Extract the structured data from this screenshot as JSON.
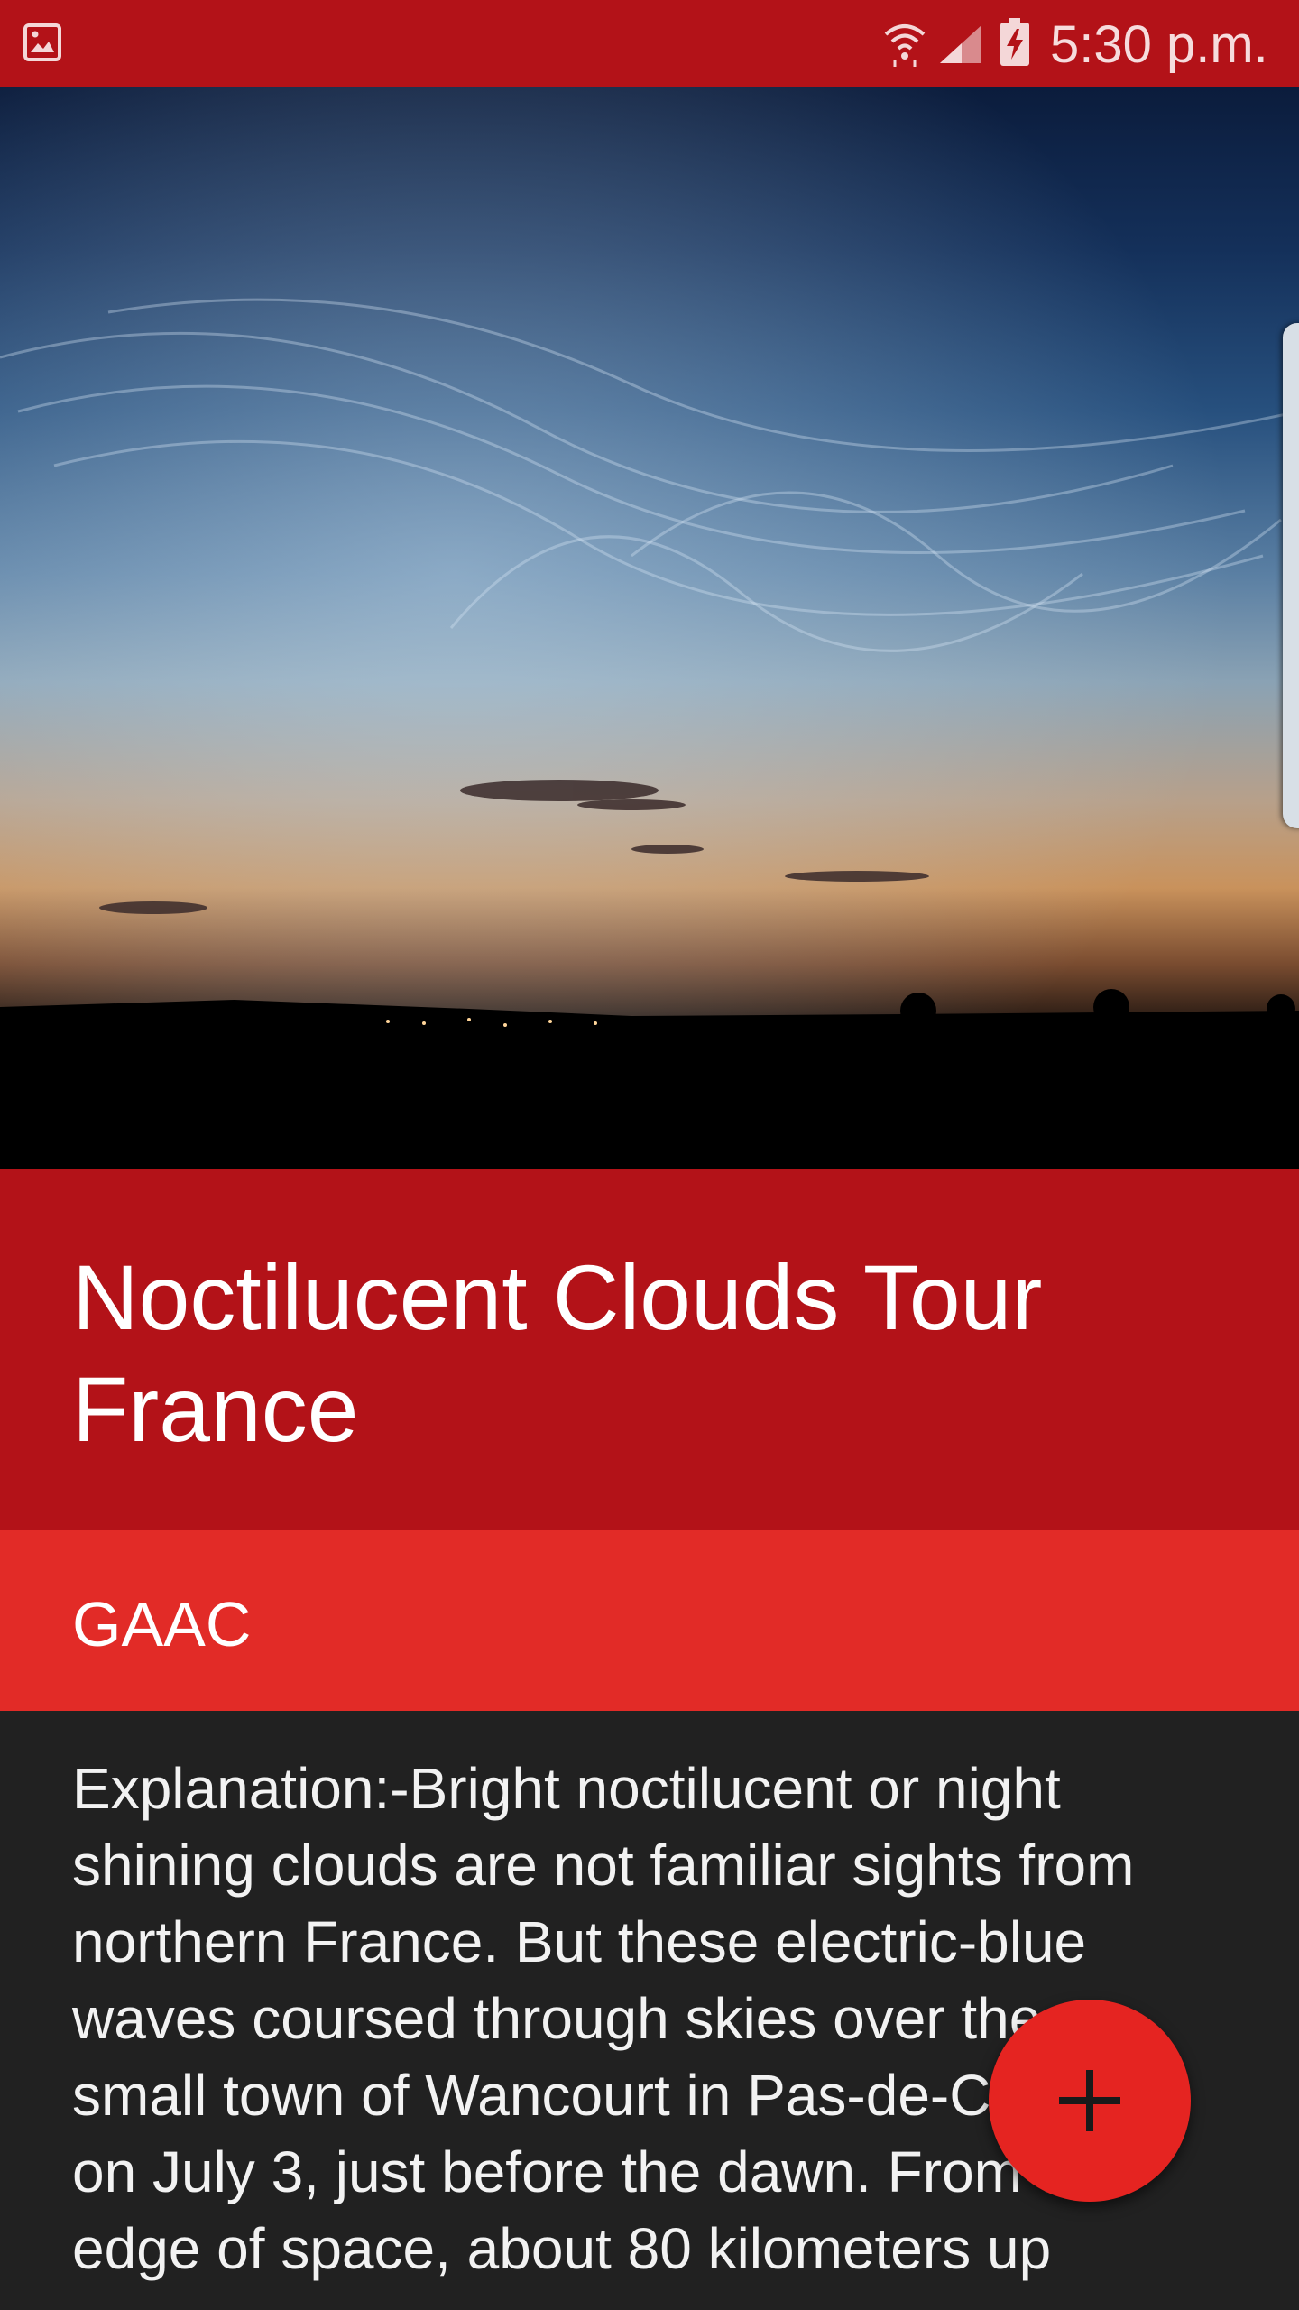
{
  "status_bar": {
    "time": "5:30 p.m.",
    "icons": [
      "gallery-icon",
      "wifi-icon",
      "signal-icon",
      "battery-charging-icon"
    ]
  },
  "hero": {
    "image": "noctilucent-clouds-photo"
  },
  "article": {
    "title": "Noctilucent Clouds Tour France",
    "author": "GAAC",
    "explanation": "Explanation:-Bright noctilucent or night shining clouds are not familiar sights from northern France. But these electric-blue waves coursed through skies over the small town of Wancourt in Pas-de-Calais on July 3, just before the dawn. From the edge of space, about 80 kilometers up"
  },
  "fab": {
    "icon": "plus-icon"
  },
  "colors": {
    "primary": "#b31218",
    "accent": "#e22b27",
    "background": "#212121",
    "fab": "#e52421"
  }
}
